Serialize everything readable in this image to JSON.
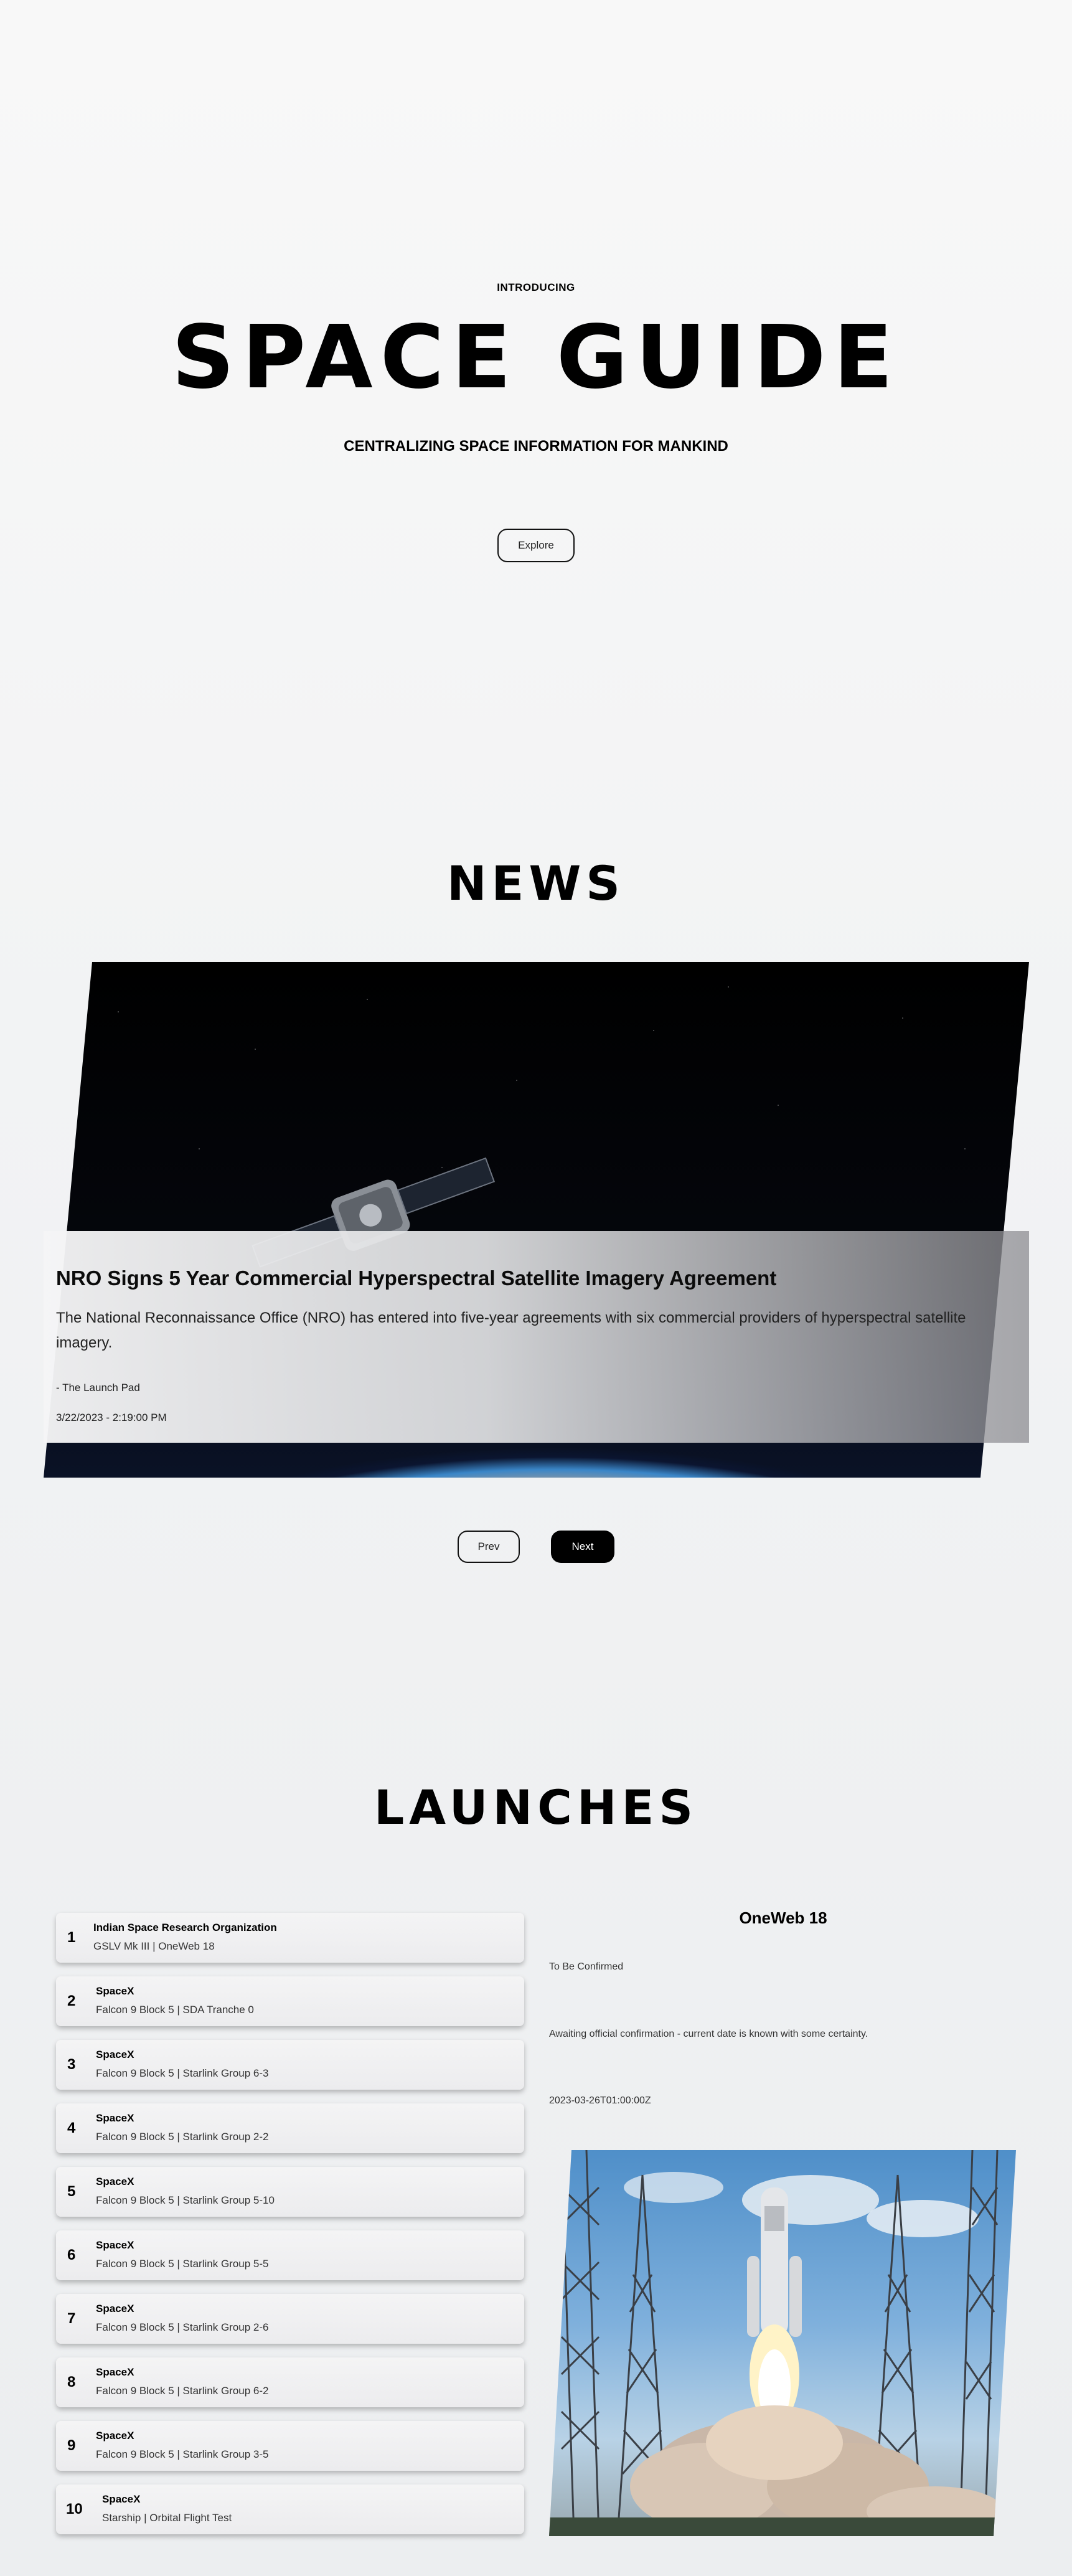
{
  "hero": {
    "intro": "INTRODUCING",
    "title": "SPACE GUIDE",
    "subtitle": "CENTRALIZING SPACE INFORMATION FOR MANKIND",
    "explore_label": "Explore"
  },
  "news": {
    "title": "NEWS",
    "article": {
      "headline": "NRO Signs 5 Year Commercial Hyperspectral Satellite Imagery Agreement",
      "description": "The National Reconnaissance Office (NRO) has entered into five-year agreements with six commercial providers of hyperspectral satellite imagery.",
      "source": "- The Launch Pad",
      "date": "3/22/2023 - 2:19:00 PM"
    },
    "prev_label": "Prev",
    "next_label": "Next"
  },
  "launches": {
    "title": "LAUNCHES",
    "items": [
      {
        "num": "1",
        "agency": "Indian Space Research Organization",
        "name": "GSLV Mk III | OneWeb 18"
      },
      {
        "num": "2",
        "agency": "SpaceX",
        "name": "Falcon 9 Block 5 | SDA Tranche 0"
      },
      {
        "num": "3",
        "agency": "SpaceX",
        "name": "Falcon 9 Block 5 | Starlink Group 6-3"
      },
      {
        "num": "4",
        "agency": "SpaceX",
        "name": "Falcon 9 Block 5 | Starlink Group 2-2"
      },
      {
        "num": "5",
        "agency": "SpaceX",
        "name": "Falcon 9 Block 5 | Starlink Group 5-10"
      },
      {
        "num": "6",
        "agency": "SpaceX",
        "name": "Falcon 9 Block 5 | Starlink Group 5-5"
      },
      {
        "num": "7",
        "agency": "SpaceX",
        "name": "Falcon 9 Block 5 | Starlink Group 2-6"
      },
      {
        "num": "8",
        "agency": "SpaceX",
        "name": "Falcon 9 Block 5 | Starlink Group 6-2"
      },
      {
        "num": "9",
        "agency": "SpaceX",
        "name": "Falcon 9 Block 5 | Starlink Group 3-5"
      },
      {
        "num": "10",
        "agency": "SpaceX",
        "name": "Starship | Orbital Flight Test"
      }
    ],
    "detail": {
      "title": "OneWeb 18",
      "status": "To Be Confirmed",
      "description": "Awaiting official confirmation - current date is known with some certainty.",
      "net": "2023-03-26T01:00:00Z"
    }
  }
}
